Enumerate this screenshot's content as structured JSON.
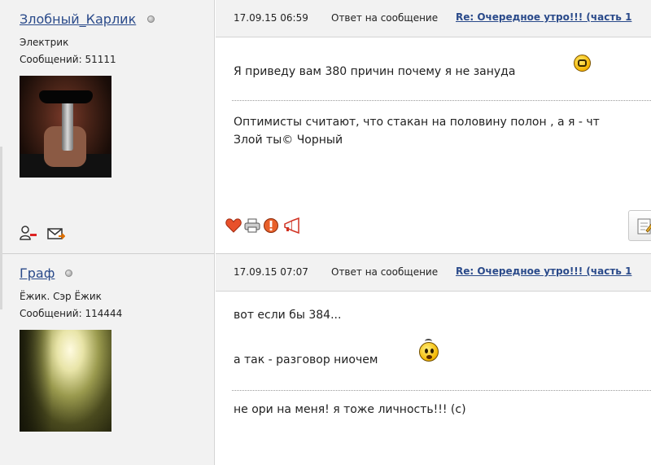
{
  "posts": [
    {
      "author": {
        "name": "Злобный_Карлик",
        "rank": "Электрик",
        "message_count": "Сообщений: 51111",
        "online": false
      },
      "header": {
        "date": "17.09.15 06:59",
        "reply_label": "Ответ на сообщение",
        "topic": "Re: Очередное утро!!! (часть 1"
      },
      "body": {
        "text": "Я приведу вам 380 причин почему я не зануда",
        "signature_line1": "Оптимисты считают, что стакан на половину полон , а я - чт",
        "signature_line2": "Злой ты© Чорный"
      },
      "actions": [
        "heart-icon",
        "print-icon",
        "report-icon",
        "megaphone-icon"
      ]
    },
    {
      "author": {
        "name": "Граф",
        "rank": "Ёжик. Сэр Ёжик",
        "message_count": "Сообщений: 114444",
        "online": false
      },
      "header": {
        "date": "17.09.15 07:07",
        "reply_label": "Ответ на сообщение",
        "topic": "Re: Очередное утро!!! (часть 1"
      },
      "body": {
        "text_line1": "вот если бы 384...",
        "text_line2": "а так - разговор ниочем",
        "signature_line1": "не ори на меня! я тоже личность!!! (с)"
      }
    }
  ],
  "colors": {
    "link": "#2a4a8a",
    "sidebar_bg": "#f2f2f2",
    "header_bg": "#f2f2f2"
  }
}
